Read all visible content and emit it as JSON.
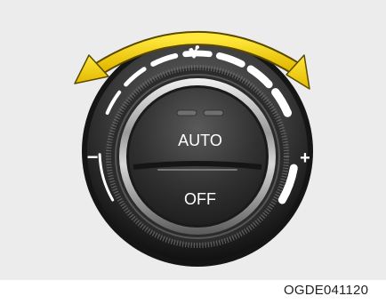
{
  "figure": {
    "code": "OGDE041120",
    "colors": {
      "arrow": "#f2cd00",
      "arrow_outline": "#5a4a00",
      "background": "#ececec",
      "knob_outer": "#1b1b1b",
      "knob_face": "#353535"
    }
  },
  "knob": {
    "speed_steps": 7,
    "fan_icon": "fan-icon",
    "decrease_symbol": "−",
    "increase_symbol": "+",
    "indicator_leds": 2,
    "rotation_arrow": "double-headed-curved-arrow"
  },
  "buttons": {
    "auto_label": "AUTO",
    "off_label": "OFF"
  }
}
